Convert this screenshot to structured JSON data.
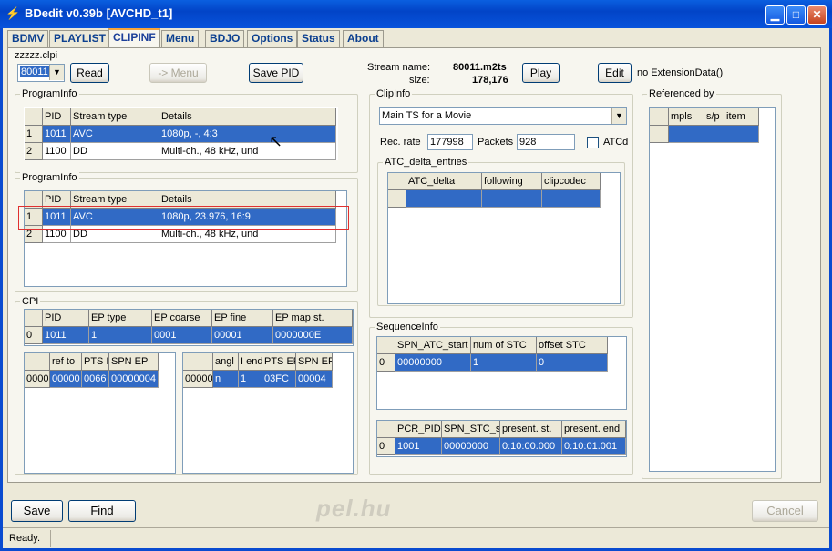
{
  "window": {
    "title": "BDedit  v0.39b [AVCHD_t1]"
  },
  "tabs": [
    "BDMV",
    "PLAYLIST",
    "CLIPINF",
    "Menu",
    "BDJO",
    "Options",
    "Status",
    "About"
  ],
  "file": {
    "name": "zzzzz.clpi",
    "clip_select": "80011",
    "read_label": "Read",
    "menu_label": "-> Menu",
    "save_pid_label": "Save PID"
  },
  "stream": {
    "name_label": "Stream name:",
    "name_value": "80011.m2ts",
    "size_label": "size:",
    "size_value": "178,176",
    "play_label": "Play",
    "edit_label": "Edit",
    "ext_label": "no ExtensionData()"
  },
  "program1": {
    "title": "ProgramInfo",
    "headers": [
      "",
      "PID",
      "Stream type",
      "Details"
    ],
    "rows": [
      [
        "1",
        "1011",
        "AVC",
        "1080p, -, 4:3"
      ],
      [
        "2",
        "1100",
        "DD",
        "Multi-ch., 48 kHz, und"
      ]
    ]
  },
  "program2": {
    "title": "ProgramInfo",
    "headers": [
      "",
      "PID",
      "Stream type",
      "Details"
    ],
    "rows": [
      [
        "1",
        "1011",
        "AVC",
        "1080p, 23.976, 16:9"
      ],
      [
        "2",
        "1100",
        "DD",
        "Multi-ch., 48 kHz, und"
      ]
    ]
  },
  "cpi": {
    "title": "CPI",
    "headers": [
      "",
      "PID",
      "EP type",
      "EP coarse",
      "EP fine",
      "EP map st."
    ],
    "rows": [
      [
        "0",
        "1011",
        "1",
        "0001",
        "00001",
        "0000000E"
      ]
    ],
    "coarse_headers": [
      "",
      "ref to",
      "PTS E",
      "SPN EP"
    ],
    "coarse_row": [
      "0000",
      "00000",
      "0066",
      "00000004"
    ],
    "fine_headers": [
      "",
      "angl",
      "I end",
      "PTS EP",
      "SPN EP"
    ],
    "fine_row": [
      "00000",
      "n",
      "1",
      "03FC",
      "00004"
    ]
  },
  "clipinfo": {
    "title": "ClipInfo",
    "type_select": "Main TS for a Movie",
    "rec_rate_label": "Rec. rate",
    "rec_rate_value": "177998",
    "packets_label": "Packets",
    "packets_value": "928",
    "atcd_label": "ATCd"
  },
  "atc": {
    "title": "ATC_delta_entries",
    "headers": [
      "",
      "ATC_delta",
      "following",
      "clipcodec"
    ]
  },
  "sequence": {
    "title": "SequenceInfo",
    "headers": [
      "",
      "SPN_ATC_start",
      "num of STC",
      "offset STC"
    ],
    "row": [
      "0",
      "00000000",
      "1",
      "0"
    ],
    "stc_headers": [
      "",
      "PCR_PID",
      "SPN_STC_st",
      "present. st.",
      "present. end"
    ],
    "stc_row": [
      "0",
      "1001",
      "00000000",
      "0:10:00.000",
      "0:10:01.001"
    ]
  },
  "referenced": {
    "title": "Referenced by",
    "headers": [
      "",
      "mpls",
      "s/p",
      "item"
    ]
  },
  "bottom": {
    "save_label": "Save",
    "find_label": "Find",
    "cancel_label": "Cancel",
    "watermark": "pel.hu"
  },
  "status": {
    "text": "Ready."
  },
  "colors": {
    "selection": "#316AC5",
    "title_bar": "#0A5FE0",
    "highlight_box": "#E03030"
  }
}
